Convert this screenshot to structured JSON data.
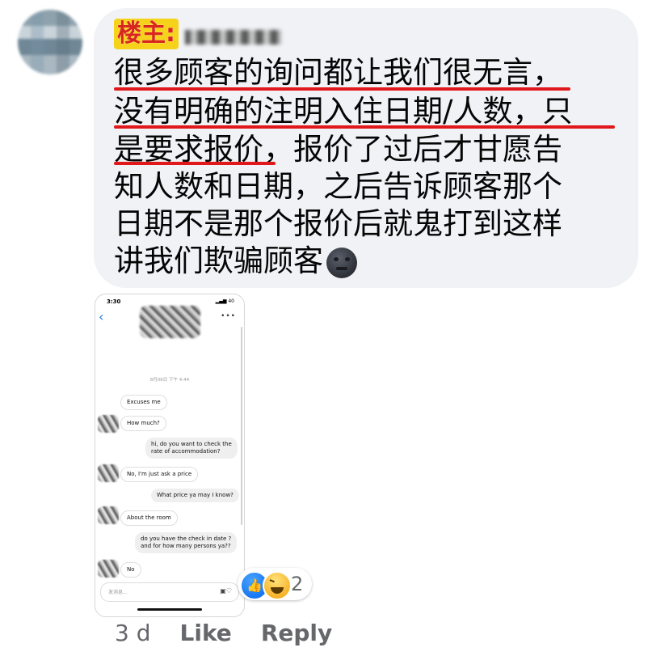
{
  "comment": {
    "author_badge": "楼主:",
    "lines": [
      "很多顾客的询问都让我们很无言，",
      "没有明确的注明入住日期/人数，只",
      "是要求报价，报价了过后才甘愿告",
      "知人数和日期，之后告诉顾客那个",
      "日期不是那个报价后就鬼打到这样",
      "讲我们欺骗顾客"
    ],
    "emoji": "new-moon-face-icon",
    "underline_color": "#e0181b"
  },
  "screenshot": {
    "status_time": "3:30",
    "status_right": "40",
    "date_label": "8月06日 下午 4:44",
    "messages": [
      {
        "dir": "in",
        "text": "Excuses me"
      },
      {
        "dir": "in",
        "text": "How much?"
      },
      {
        "dir": "out",
        "text": "hi, do you want to check the\nrate of accommodation?"
      },
      {
        "dir": "in",
        "text": "No, I'm just ask a price"
      },
      {
        "dir": "out",
        "text": "What price ya may I know?"
      },
      {
        "dir": "in",
        "text": "About the room"
      },
      {
        "dir": "out",
        "text": "do you have the check in date ?\nand for how many persons ya??"
      },
      {
        "dir": "in",
        "text": "No"
      }
    ],
    "input_placeholder": "发消息..."
  },
  "reactions": {
    "icons": [
      "like-icon",
      "haha-icon"
    ],
    "count": "2"
  },
  "footer": {
    "time": "3 d",
    "like_label": "Like",
    "reply_label": "Reply"
  },
  "colors": {
    "bubble": "#f0f2f5",
    "badge_bg": "#f7d21b",
    "badge_text": "#d8261f",
    "meta_text": "#65676b",
    "like_blue": "#1877f2"
  }
}
